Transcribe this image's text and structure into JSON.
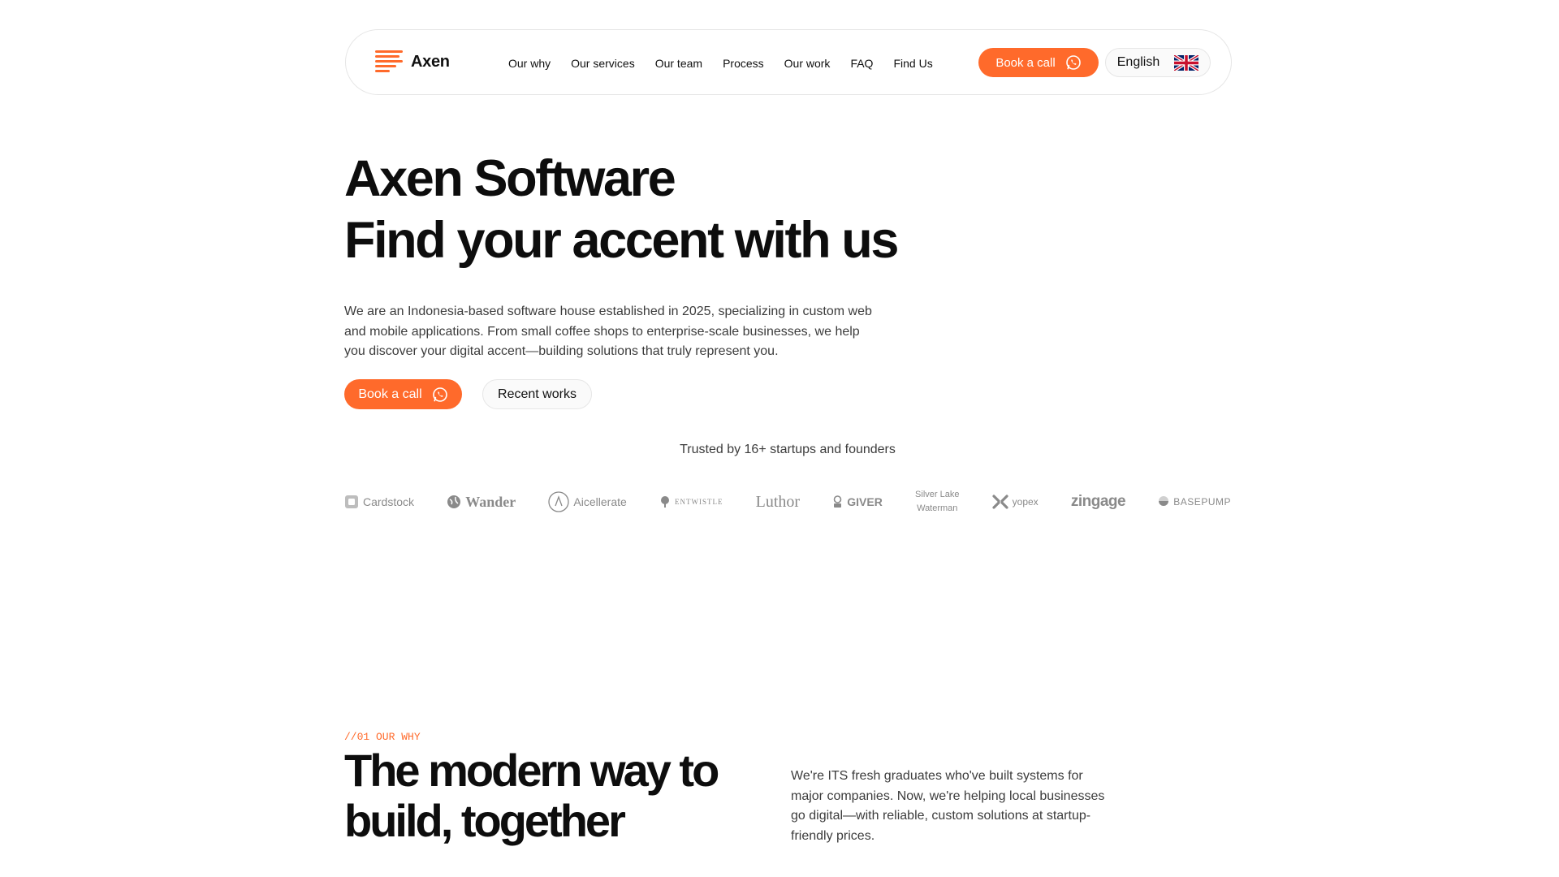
{
  "nav": {
    "brand": "Axen",
    "links": [
      "Our why",
      "Our services",
      "Our team",
      "Process",
      "Our work",
      "FAQ",
      "Find Us"
    ],
    "cta_label": "Book a call",
    "language": "English"
  },
  "hero": {
    "title_line1": "Axen Software",
    "title_line2": "Find your accent with us",
    "description": "We are an Indonesia-based software house established in 2025, specializing in custom web and mobile applications. From small coffee shops to enterprise-scale businesses, we help you discover your digital accent—building solutions that truly represent you.",
    "primary_button": "Book a call",
    "secondary_button": "Recent works",
    "trusted": "Trusted by 16+ startups and founders"
  },
  "logos": {
    "cardstock": "Cardstock",
    "wander": "Wander",
    "aicellerate": "Aicellerate",
    "entwistle": "ENTWISTLE",
    "luthor": "Luthor",
    "giver": "GIVER",
    "silver_line1": "Silver Lake",
    "silver_line2": "Waterman",
    "yopex": "yopex",
    "zingage": "zingage",
    "basepump": "BASEPUMP"
  },
  "section_why": {
    "eyebrow": "//01 OUR WHY",
    "title": "The modern way to build, together",
    "description": "We're ITS fresh graduates who've built systems for major companies. Now, we're helping local businesses go digital—with reliable, custom solutions at startup-friendly prices."
  },
  "colors": {
    "accent": "#ff6a2b",
    "text": "#111111",
    "muted": "#3c3c3c",
    "logo_gray": "#8a8a8a"
  },
  "icons": {
    "brand": "axen-lines-icon",
    "cta": "whatsapp-icon",
    "language": "uk-flag-icon"
  }
}
